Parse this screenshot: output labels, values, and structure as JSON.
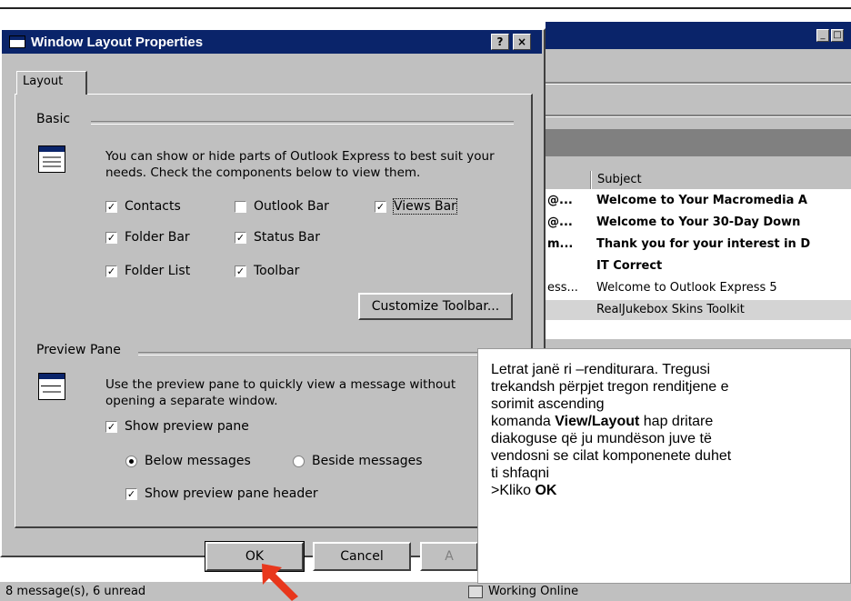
{
  "dialog": {
    "title": "Window Layout Properties",
    "help_label": "?",
    "close_label": "×",
    "tab_label": "Layout",
    "basic": {
      "group_label": "Basic",
      "description": "You can show or hide parts of Outlook Express to best suit your needs.  Check the components below to view them.",
      "checkboxes": [
        {
          "label": "Contacts",
          "checked": true
        },
        {
          "label": "Outlook Bar",
          "checked": false
        },
        {
          "label": "Views Bar",
          "checked": true
        },
        {
          "label": "Folder Bar",
          "checked": true
        },
        {
          "label": "Status Bar",
          "checked": true
        },
        {
          "label": "Folder List",
          "checked": true
        },
        {
          "label": "Toolbar",
          "checked": true
        }
      ],
      "customize_button": "Customize Toolbar..."
    },
    "preview": {
      "group_label": "Preview Pane",
      "description": "Use the preview pane to quickly view a message without opening a separate window.",
      "show_preview": {
        "label": "Show preview pane",
        "checked": true
      },
      "below": {
        "label": "Below messages",
        "selected": true
      },
      "beside": {
        "label": "Beside messages",
        "selected": false
      },
      "show_header": {
        "label": "Show preview pane header",
        "checked": true
      }
    },
    "ok_label": "OK",
    "cancel_label": "Cancel",
    "apply_label": "A"
  },
  "background": {
    "column_subject": "Subject",
    "messages": [
      {
        "from": "@...",
        "subject": "Welcome to Your Macromedia A",
        "bold": true
      },
      {
        "from": "@...",
        "subject": "Welcome to Your 30-Day Down",
        "bold": true
      },
      {
        "from": "m...",
        "subject": "Thank you for your interest in D",
        "bold": true
      },
      {
        "from": "",
        "subject": "IT Correct",
        "bold": true
      },
      {
        "from": "ess...",
        "subject": "Welcome to Outlook Express 5",
        "bold": false
      },
      {
        "from": "",
        "subject": "RealJukebox Skins Toolkit",
        "bold": false
      }
    ],
    "status_left": "8 message(s), 6 unread",
    "status_right": "Working Online"
  },
  "note": {
    "line1": "Letrat janë ri –renditurara. Tregusi",
    "line2": "trekandsh përpjet tregon   renditjene e",
    "line3": "sorimit ascending",
    "line4_prefix": "komanda ",
    "line4_bold": "View/Layout",
    "line4_suffix": "  hap dritare",
    "line5": "diakoguse që ju mundëson juve të",
    "line6": "vendosni  se cilat komponenete duhet",
    "line7": "ti shfaqni",
    "line8_prefix": ">Kliko ",
    "line8_bold": "OK"
  },
  "colors": {
    "titlebar": "#0a246a",
    "face": "#c0c0c0",
    "arrow": "#e8371c"
  }
}
